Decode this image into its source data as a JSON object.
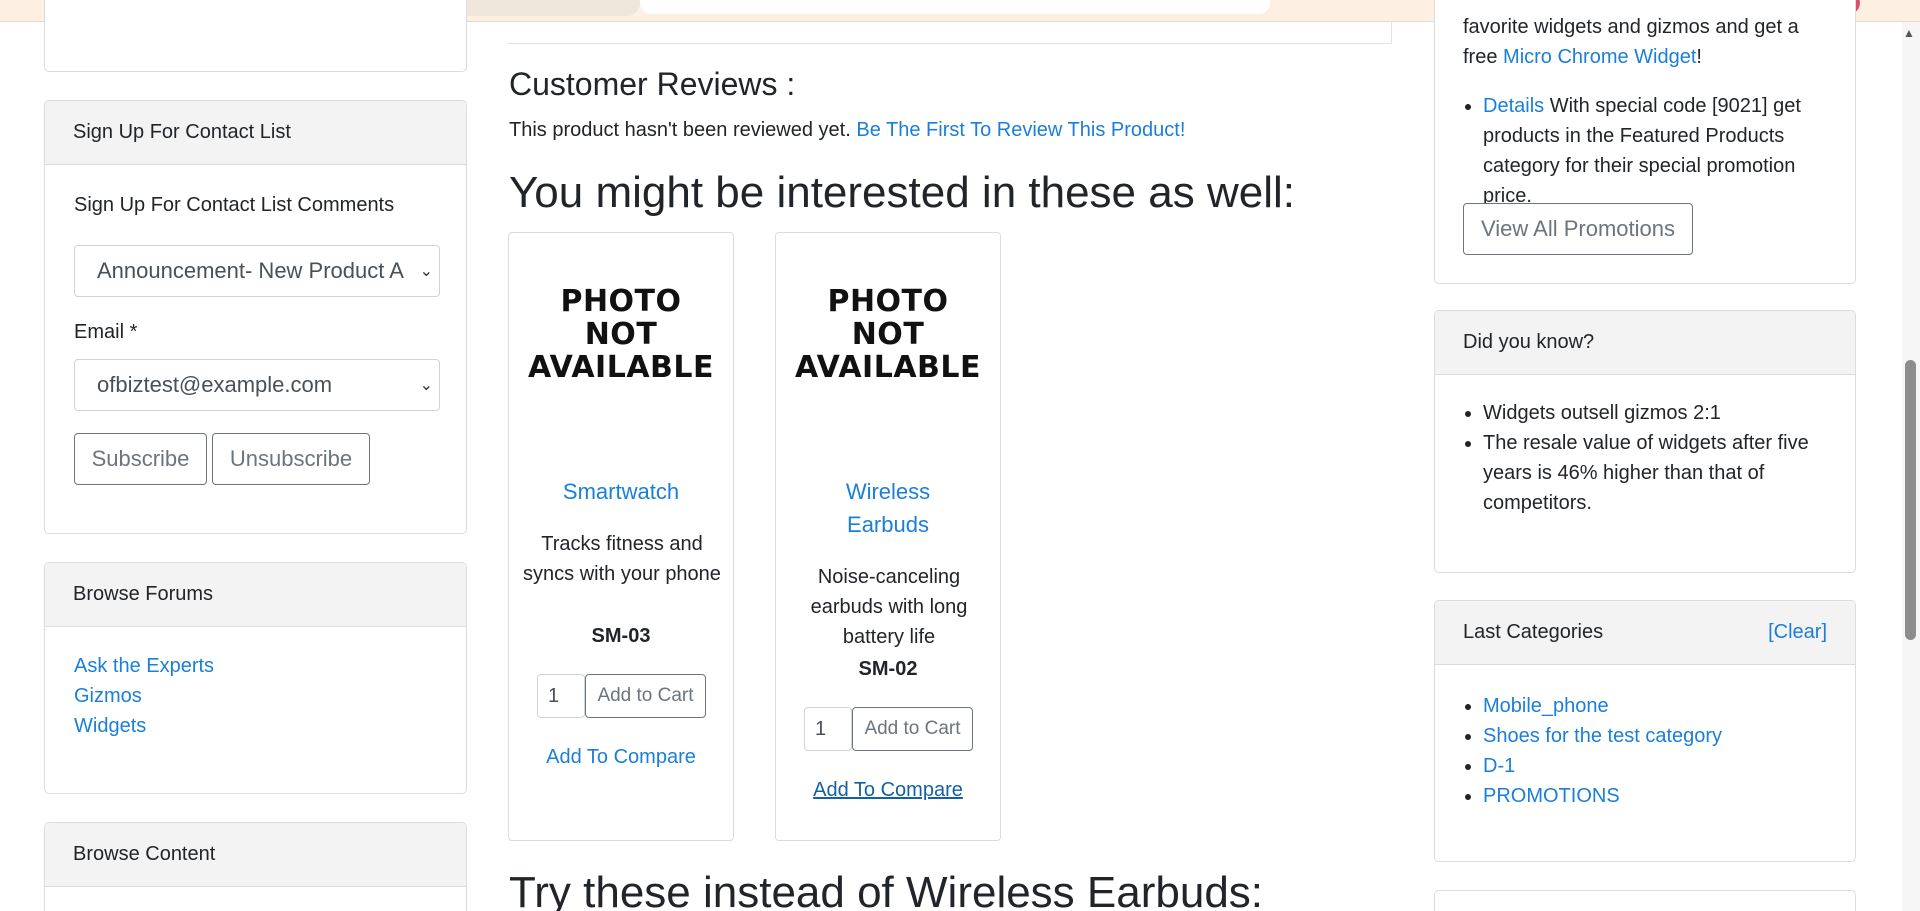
{
  "left": {
    "signup": {
      "title": "Sign Up For Contact List",
      "comments_label": "Sign Up For Contact List Comments",
      "comments_value": "Announcement- New Product Announcement",
      "email_label": "Email *",
      "email_value": "ofbiztest@example.com",
      "subscribe": "Subscribe",
      "unsubscribe": "Unsubscribe"
    },
    "forums": {
      "title": "Browse Forums",
      "links": [
        "Ask the Experts",
        "Gizmos",
        "Widgets"
      ]
    },
    "content": {
      "title": "Browse Content"
    }
  },
  "center": {
    "reviews_title": "Customer Reviews :",
    "reviews_text": "This product hasn't been reviewed yet.",
    "reviews_link": "Be The First To Review This Product!",
    "interested_title": "You might be interested in these as well:",
    "photo_placeholder": [
      "PHOTO",
      "NOT",
      "AVAILABLE"
    ],
    "products": [
      {
        "name": "Smartwatch",
        "description": "Tracks fitness and syncs with your phone",
        "sku": "SM-03",
        "qty": "1",
        "add_to_cart": "Add to Cart",
        "compare": "Add To Compare"
      },
      {
        "name": "Wireless Earbuds",
        "description": "Noise-canceling earbuds with long battery life",
        "sku": "SM-02",
        "qty": "1",
        "add_to_cart": "Add to Cart",
        "compare": "Add To Compare"
      }
    ],
    "try_instead_title": "Try these instead of Wireless Earbuds:"
  },
  "right": {
    "promo": {
      "line1": "favorite widgets and gizmos and get a",
      "line2_prefix": "free ",
      "line2_link": "Micro Chrome Widget",
      "line2_suffix": "!",
      "details_link": "Details",
      "details_text": " With special code [9021] get products in the Featured Products category for their special promotion price.",
      "view_all": "View All Promotions"
    },
    "didyouknow": {
      "title": "Did you know?",
      "items": [
        "Widgets outsell gizmos 2:1",
        "The resale value of widgets after five years is 46% higher than that of competitors."
      ]
    },
    "lastcats": {
      "title": "Last Categories",
      "clear": "[Clear]",
      "items": [
        "Mobile_phone",
        "Shoes for the test category",
        "D-1",
        "PROMOTIONS"
      ]
    }
  }
}
